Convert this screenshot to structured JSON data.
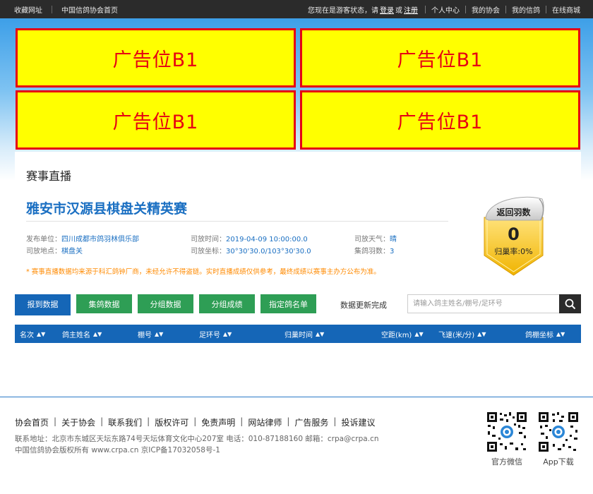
{
  "topbar": {
    "bookmark": "收藏网址",
    "home": "中国信鸽协会首页",
    "guest_prefix": "您现在是游客状态，请",
    "login": "登录",
    "or": "或",
    "register": "注册",
    "nav": [
      "个人中心",
      "我的协会",
      "我的信鸽",
      "在线商城"
    ]
  },
  "ads": [
    "广告位B1",
    "广告位B1",
    "广告位B1",
    "广告位B1"
  ],
  "section_title": "赛事直播",
  "race": {
    "title": "雅安市汉源县棋盘关精英赛",
    "publisher_label": "发布单位：",
    "publisher": "四川成都市鸽羽林俱乐部",
    "release_time_label": "司放时间：",
    "release_time": "2019-04-09 10:00:00.0",
    "weather_label": "司放天气：",
    "weather": "晴",
    "location_label": "司放地点：",
    "location": "棋盘关",
    "coords_label": "司放坐标：",
    "coords": "30°30'30.0/103°30'30.0",
    "count_label": "集鸽羽数：",
    "count": "3",
    "notice": "* 赛事直播数据均来源于科汇鸽钟厂商，未经允许不得盗链。实时直播成绩仅供参考，最终成绩以赛事主办方公布为准。"
  },
  "badge": {
    "title": "返回羽数",
    "value": "0",
    "rate": "归巢率:0%"
  },
  "tabs": [
    "报到数据",
    "集鸽数据",
    "分组数据",
    "分组成绩",
    "指定鸽名单"
  ],
  "status": "数据更新完成",
  "search": {
    "placeholder": "请输入鸽主姓名/棚号/足环号"
  },
  "table": {
    "columns": [
      "名次",
      "鸽主姓名",
      "棚号",
      "足环号",
      "归巢时间",
      "空距(km)",
      "飞速(米/分)",
      "鸽棚坐标"
    ]
  },
  "footer": {
    "links": [
      "协会首页",
      "关于协会",
      "联系我们",
      "版权许可",
      "免责声明",
      "网站律师",
      "广告服务",
      "投诉建议"
    ],
    "address": "联系地址：北京市东城区天坛东路74号天坛体育文化中心207室 电话：010-87188160 邮箱：crpa@crpa.cn",
    "copyright": "中国信鸽协会版权所有 www.crpa.cn 京ICP备17032058号-1",
    "qr_labels": [
      "官方微信",
      "App下载"
    ]
  },
  "colors": {
    "primary_blue": "#1566b7",
    "tab_green": "#2e9e55",
    "ad_yellow": "#ffff00",
    "ad_red": "#e60012",
    "notice_orange": "#ff8a00"
  }
}
